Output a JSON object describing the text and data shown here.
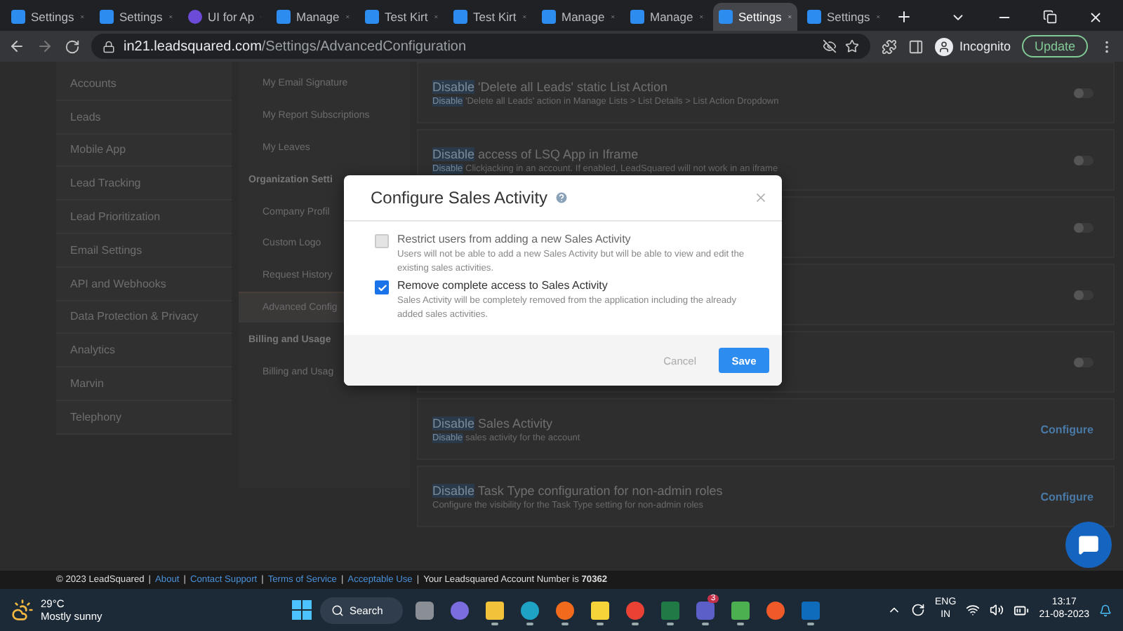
{
  "browser": {
    "tabs": [
      {
        "title": "Settings",
        "kind": "site",
        "selected": false
      },
      {
        "title": "Settings",
        "kind": "site",
        "selected": false
      },
      {
        "title": "UI for Ap",
        "kind": "media",
        "selected": false
      },
      {
        "title": "Manage",
        "kind": "site",
        "selected": false
      },
      {
        "title": "Test Kirt",
        "kind": "site",
        "selected": false
      },
      {
        "title": "Test Kirt",
        "kind": "site",
        "selected": false
      },
      {
        "title": "Manage",
        "kind": "site",
        "selected": false
      },
      {
        "title": "Manage",
        "kind": "site",
        "selected": false
      },
      {
        "title": "Settings",
        "kind": "site",
        "selected": true
      },
      {
        "title": "Settings",
        "kind": "site",
        "selected": false
      }
    ],
    "url_host": "in21.leadsquared.com",
    "url_path": "/Settings/AdvancedConfiguration",
    "profile": "Incognito",
    "update_button": "Update"
  },
  "nav": {
    "items": [
      {
        "label": "Accounts"
      },
      {
        "label": "Leads"
      },
      {
        "label": "Mobile App"
      },
      {
        "label": "Lead Tracking"
      },
      {
        "label": "Lead Prioritization"
      },
      {
        "label": "Email Settings"
      },
      {
        "label": "API and Webhooks"
      },
      {
        "label": "Data Protection & Privacy"
      },
      {
        "label": "Analytics"
      },
      {
        "label": "Marvin"
      },
      {
        "label": "Telephony"
      }
    ]
  },
  "subnav": {
    "items": [
      {
        "kind": "item",
        "label": "My Email Signature",
        "selected": false
      },
      {
        "kind": "item",
        "label": "My Report Subscriptions",
        "selected": false
      },
      {
        "kind": "item",
        "label": "My Leaves",
        "selected": false
      },
      {
        "kind": "header",
        "label": "Organization Setti"
      },
      {
        "kind": "item",
        "label": "Company Profil",
        "selected": false
      },
      {
        "kind": "item",
        "label": "Custom Logo",
        "selected": false
      },
      {
        "kind": "item",
        "label": "Request History",
        "selected": false
      },
      {
        "kind": "item",
        "label": "Advanced Config",
        "selected": true
      },
      {
        "kind": "header",
        "label": "Billing and Usage"
      },
      {
        "kind": "item",
        "label": "Billing and Usag",
        "selected": false
      }
    ]
  },
  "settings": [
    {
      "kind": "toggle",
      "match": "Disable",
      "title": " 'Delete all Leads' static List Action",
      "desc_match": "Disable",
      "desc": " 'Delete all Leads' action in Manage Lists > List Details > List Action Dropdown",
      "on": false
    },
    {
      "kind": "toggle",
      "match": "Disable",
      "title": " access of LSQ App in Iframe",
      "desc_match": "Disable",
      "desc": " Clickjacking in an account. If enabled, LeadSquared will not work in an iframe",
      "on": false
    },
    {
      "kind": "toggle",
      "on": false
    },
    {
      "kind": "toggle",
      "on": false
    },
    {
      "kind": "toggle",
      "on": false
    },
    {
      "kind": "configure",
      "match": "Disable",
      "title": " Sales Activity",
      "desc_match": "Disable",
      "desc": " sales activity for the account",
      "action": "Configure"
    },
    {
      "kind": "configure",
      "match": "Disable",
      "title": " Task Type configuration for non-admin roles",
      "desc": "Configure the visibility for the Task Type setting for non-admin roles",
      "action": "Configure"
    }
  ],
  "dialog": {
    "title": "Configure Sales Activity",
    "options": [
      {
        "label": "Restrict users from adding a new Sales Activity",
        "desc": "Users will not be able to add a new Sales Activity but will be able to view and edit the existing sales activities.",
        "checked": false,
        "disabled": true
      },
      {
        "label": "Remove complete access to Sales Activity",
        "desc": "Sales Activity will be completely removed from the application including the already added sales activities.",
        "checked": true,
        "disabled": false
      }
    ],
    "cancel": "Cancel",
    "save": "Save"
  },
  "footer": {
    "copyright": "© 2023 LeadSquared",
    "separator": "|",
    "links": [
      "About",
      "Contact Support",
      "Terms of Service",
      "Acceptable Use"
    ],
    "account_text": "Your Leadsquared Account Number is",
    "account_number": "70362"
  },
  "taskbar": {
    "temperature": "29°C",
    "weather": "Mostly sunny",
    "search": "Search",
    "apps": [
      {
        "kind": "taskview",
        "running": false
      },
      {
        "kind": "meet",
        "running": false
      },
      {
        "kind": "files",
        "running": true
      },
      {
        "kind": "edge",
        "running": true
      },
      {
        "kind": "firefox",
        "running": true
      },
      {
        "kind": "notes",
        "running": true
      },
      {
        "kind": "chrome",
        "running": true
      },
      {
        "kind": "excel",
        "running": true
      },
      {
        "kind": "teams",
        "running": true,
        "badge": "3"
      },
      {
        "kind": "notepad",
        "running": true
      },
      {
        "kind": "paint",
        "running": false
      },
      {
        "kind": "outlook",
        "running": true
      }
    ],
    "lang": "ENG",
    "region": "IN",
    "time": "13:17",
    "date": "21-08-2023"
  }
}
